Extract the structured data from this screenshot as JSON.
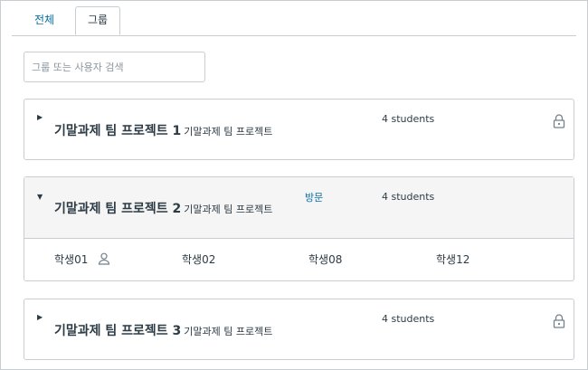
{
  "tabs": {
    "all_label": "전체",
    "group_label": "그룹"
  },
  "search": {
    "placeholder": "그룹 또는 사용자 검색"
  },
  "groups": [
    {
      "name": "기말과제 팀 프로젝트 1",
      "category": "기말과제 팀 프로젝트",
      "count": "4 students",
      "locked": true
    },
    {
      "name": "기말과제 팀 프로젝트 2",
      "category": "기말과제 팀 프로젝트",
      "count": "4 students",
      "visit_label": "방문",
      "members": [
        "학생01",
        "학생02",
        "학생08",
        "학생12"
      ]
    },
    {
      "name": "기말과제 팀 프로젝트 3",
      "category": "기말과제 팀 프로젝트",
      "count": "4 students",
      "locked": true
    }
  ],
  "icons": {
    "toggle_collapsed": "caret-right-icon",
    "toggle_expanded": "caret-down-icon",
    "lock": "lock-icon",
    "leader": "user-icon"
  },
  "colors": {
    "link": "#0770a3",
    "border": "#c7cdd1",
    "text": "#2d3b45",
    "expanded_bg": "#f5f5f5"
  }
}
